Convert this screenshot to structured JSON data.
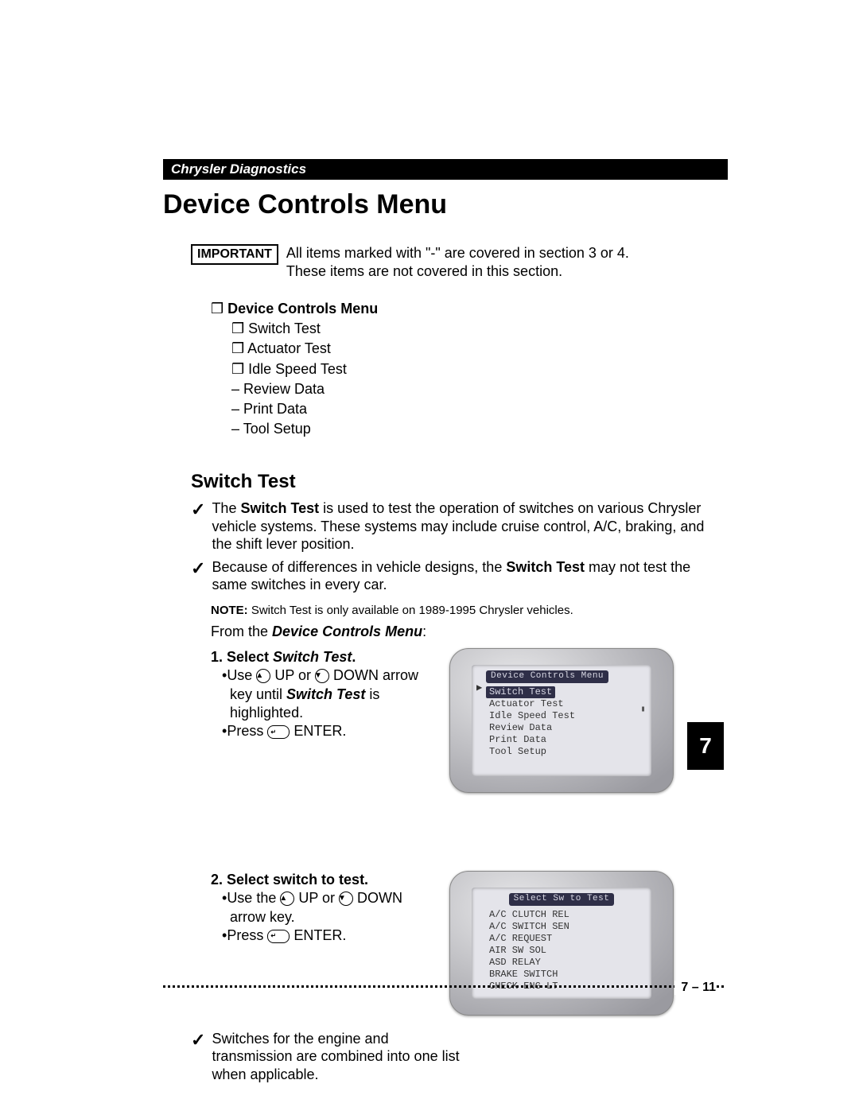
{
  "header": {
    "brand": "Chrysler Diagnostics"
  },
  "title": "Device Controls Menu",
  "important": {
    "label": "IMPORTANT",
    "text_line1": "All items marked with \"-\" are covered in section 3 or 4.",
    "text_line2": "These items are not covered in this section."
  },
  "menu": {
    "box": "❒",
    "heading": "Device Controls Menu",
    "items_box": [
      "Switch Test",
      "Actuator Test",
      "Idle Speed Test"
    ],
    "items_dash": [
      "Review Data",
      "Print Data",
      "Tool Setup"
    ]
  },
  "section": {
    "heading": "Switch Test",
    "check1_a": "The ",
    "check1_bold": "Switch Test",
    "check1_b": " is used to test the operation of switches on various Chrysler vehicle systems. These systems may include cruise control, A/C, braking, and the shift lever position.",
    "check2_a": "Because of differences in vehicle designs, the ",
    "check2_bold": "Switch Test",
    "check2_b": " may not test the same switches in every car.",
    "note_label": "NOTE:",
    "note_text": " Switch Test is only available on 1989-1995 Chrysler vehicles.",
    "from_a": "From the ",
    "from_bold": "Device Controls Menu",
    "from_b": ":"
  },
  "steps": {
    "s1_head_a": "1. Select ",
    "s1_head_bold": "Switch Test",
    "s1_head_b": ".",
    "s1_bullet1_a": "Use ",
    "s1_bullet1_b": " UP or ",
    "s1_bullet1_c": " DOWN arrow key until ",
    "s1_bullet1_bold": "Switch Test",
    "s1_bullet1_d": " is highlighted.",
    "s1_bullet2_a": "Press ",
    "s1_bullet2_b": " ENTER.",
    "s2_head": "2. Select switch to test.",
    "s2_bullet1_a": "Use the ",
    "s2_bullet1_b": " UP or ",
    "s2_bullet1_c": " DOWN arrow key.",
    "s2_bullet2_a": "Press ",
    "s2_bullet2_b": " ENTER."
  },
  "bottom_check": "Switches for the engine and transmission are combined into one list when applicable.",
  "screen1": {
    "title": "Device Controls Menu",
    "highlight": "Switch Test",
    "lines": [
      "Actuator Test",
      "Idle Speed Test",
      "Review Data",
      "Print Data",
      "Tool Setup"
    ]
  },
  "screen2": {
    "title": "Select Sw to Test",
    "lines": [
      "A/C CLUTCH REL",
      "A/C SWITCH SEN",
      "A/C REQUEST",
      "AIR SW SOL",
      "ASD RELAY",
      "BRAKE SWITCH",
      "CHECK ENG LT"
    ]
  },
  "icons": {
    "up": "▲",
    "down": "▼",
    "enter": "↵"
  },
  "side_tab": "7",
  "page_number": "7 – 11"
}
